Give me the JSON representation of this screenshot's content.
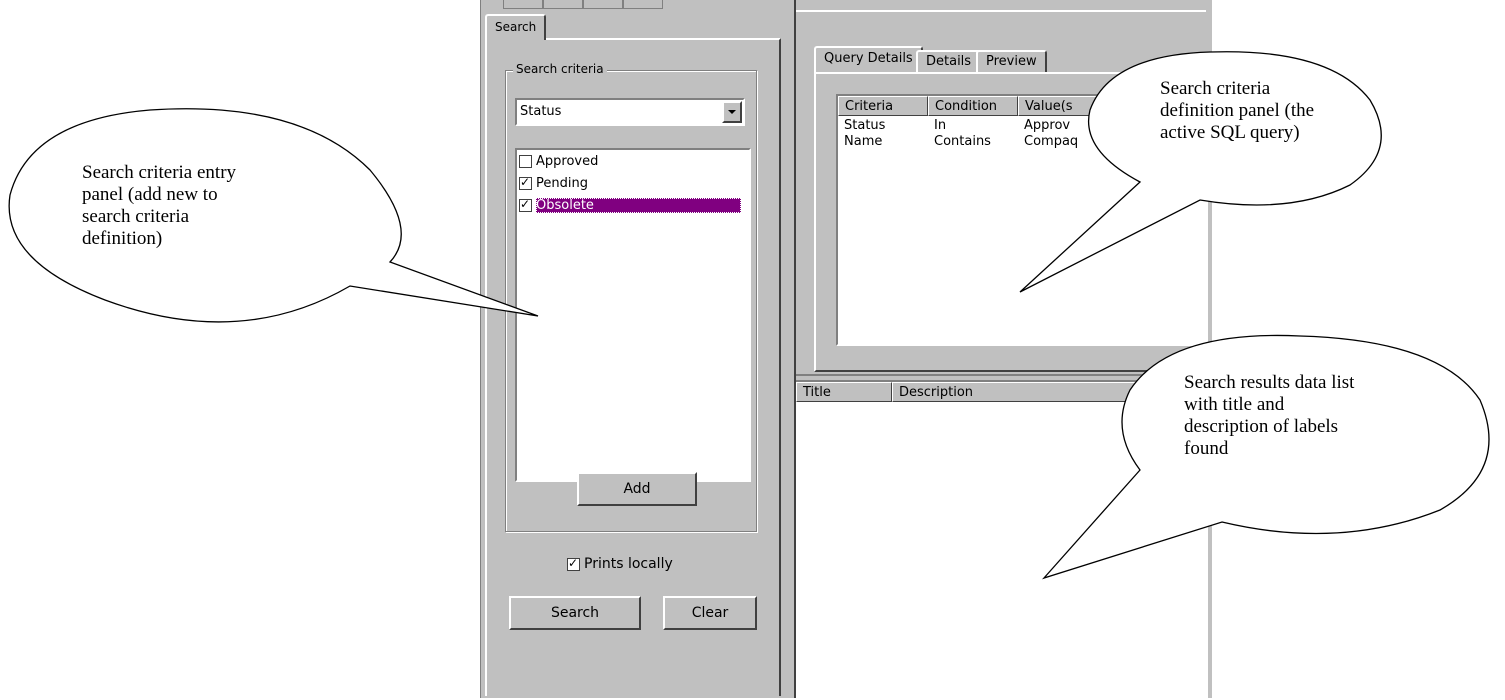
{
  "left_panel": {
    "tab_label": "Search",
    "group_legend": "Search criteria",
    "field_dropdown_value": "Status",
    "options": [
      {
        "label": "Approved",
        "checked": false,
        "selected": false
      },
      {
        "label": "Pending",
        "checked": true,
        "selected": false
      },
      {
        "label": "Obsolete",
        "checked": true,
        "selected": true
      }
    ],
    "add_button": "Add",
    "prints_locally_label": "Prints locally",
    "prints_locally_checked": true,
    "search_button": "Search",
    "clear_button": "Clear"
  },
  "right_panel": {
    "tabs": [
      "Query Details",
      "Details",
      "Preview"
    ],
    "criteria_columns": [
      "Criteria",
      "Condition",
      "Value(s"
    ],
    "criteria_rows": [
      [
        "Status",
        "In",
        "Approv"
      ],
      [
        "Name",
        "Contains",
        "Compaq"
      ]
    ],
    "results_columns": [
      "Title",
      "Description"
    ]
  },
  "callouts": {
    "entry_panel": [
      "Search criteria entry",
      "panel (add new to",
      "search criteria",
      "definition)"
    ],
    "definition_panel": [
      "Search criteria",
      "definition panel (the",
      "active SQL query)"
    ],
    "results_list": [
      "Search results data list",
      "with title and",
      "description of labels",
      "found"
    ]
  },
  "colors": {
    "face": "#c0c0c0",
    "selection": "#800080"
  }
}
